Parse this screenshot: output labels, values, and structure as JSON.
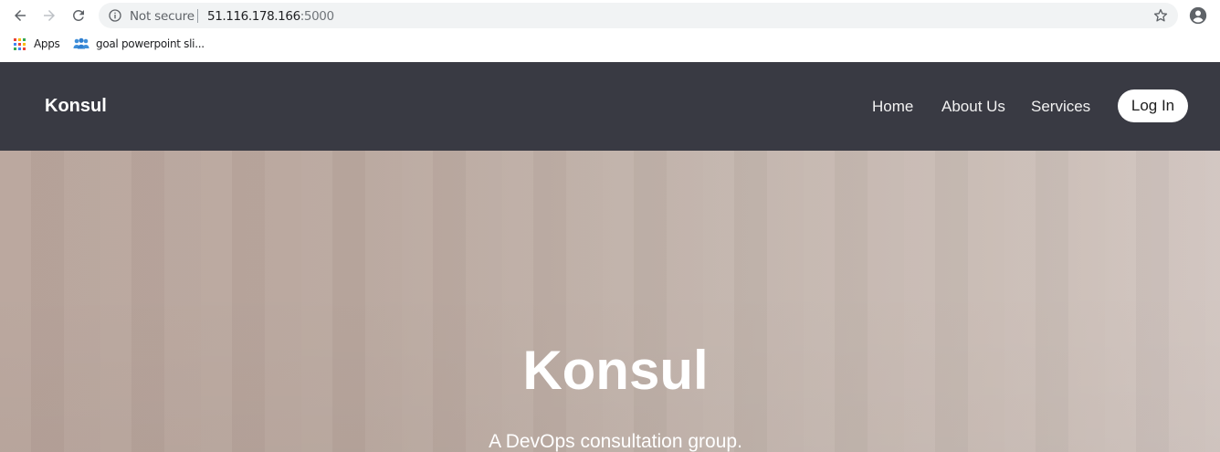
{
  "browser": {
    "security_label": "Not secure",
    "url_host": "51.116.178.166",
    "url_port": ":5000",
    "bookmarks": [
      {
        "label": "Apps",
        "icon": "apps-grid-icon"
      },
      {
        "label": "goal powerpoint sli...",
        "icon": "people-group-icon"
      }
    ]
  },
  "site": {
    "brand": "Konsul",
    "nav": [
      "Home",
      "About Us",
      "Services"
    ],
    "login_label": "Log In",
    "colors": {
      "navbar": "#393a43",
      "hero_start": "#b9a59c",
      "hero_end": "#d1c5c0"
    }
  },
  "hero": {
    "title": "Konsul",
    "subtitle": "A DevOps consultation group."
  }
}
